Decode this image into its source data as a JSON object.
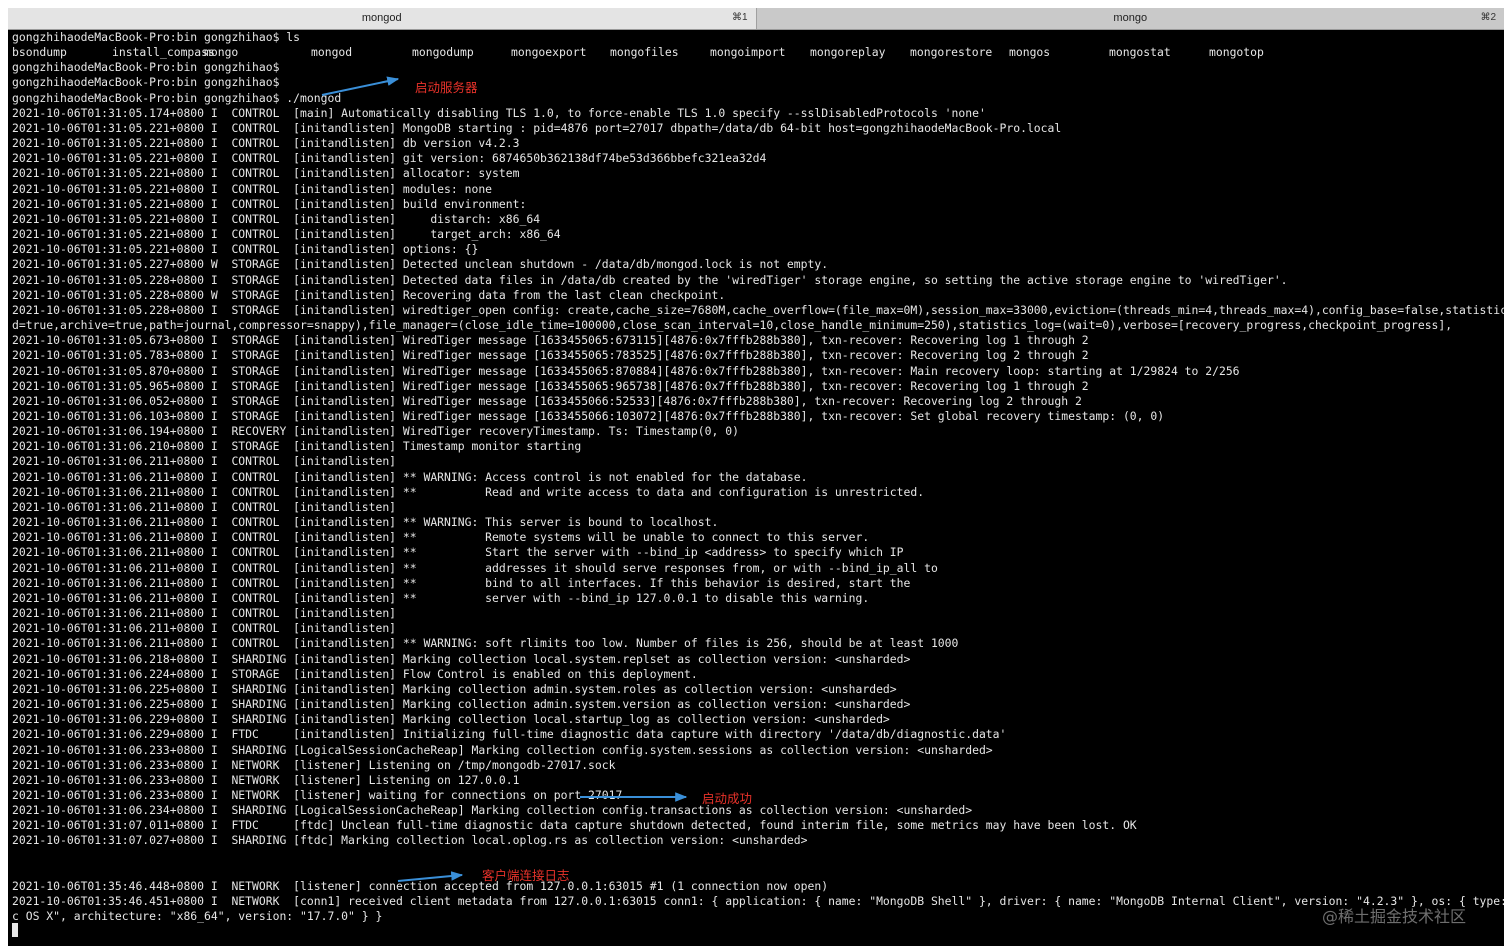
{
  "tabs": [
    {
      "title": "mongod",
      "shortcut": "⌘1"
    },
    {
      "title": "mongo",
      "shortcut": "⌘2"
    }
  ],
  "ls_line": "gongzhihaodeMacBook-Pro:bin gongzhihao$ ls",
  "ls_files": [
    "bsondump",
    "install_compass",
    "mongo",
    "mongod",
    "mongodump",
    "mongoexport",
    "mongofiles",
    "mongoimport",
    "mongoreplay",
    "mongorestore",
    "mongos",
    "mongostat",
    "mongotop"
  ],
  "prompt_lines": [
    "gongzhihaodeMacBook-Pro:bin gongzhihao$",
    "gongzhihaodeMacBook-Pro:bin gongzhihao$",
    "gongzhihaodeMacBook-Pro:bin gongzhihao$ ./mongod"
  ],
  "log1": [
    "2021-10-06T01:31:05.174+0800 I  CONTROL  [main] Automatically disabling TLS 1.0, to force-enable TLS 1.0 specify --sslDisabledProtocols 'none'",
    "2021-10-06T01:31:05.221+0800 I  CONTROL  [initandlisten] MongoDB starting : pid=4876 port=27017 dbpath=/data/db 64-bit host=gongzhihaodeMacBook-Pro.local",
    "2021-10-06T01:31:05.221+0800 I  CONTROL  [initandlisten] db version v4.2.3",
    "2021-10-06T01:31:05.221+0800 I  CONTROL  [initandlisten] git version: 6874650b362138df74be53d366bbefc321ea32d4",
    "2021-10-06T01:31:05.221+0800 I  CONTROL  [initandlisten] allocator: system",
    "2021-10-06T01:31:05.221+0800 I  CONTROL  [initandlisten] modules: none",
    "2021-10-06T01:31:05.221+0800 I  CONTROL  [initandlisten] build environment:",
    "2021-10-06T01:31:05.221+0800 I  CONTROL  [initandlisten]     distarch: x86_64",
    "2021-10-06T01:31:05.221+0800 I  CONTROL  [initandlisten]     target_arch: x86_64",
    "2021-10-06T01:31:05.221+0800 I  CONTROL  [initandlisten] options: {}",
    "2021-10-06T01:31:05.227+0800 W  STORAGE  [initandlisten] Detected unclean shutdown - /data/db/mongod.lock is not empty.",
    "2021-10-06T01:31:05.228+0800 I  STORAGE  [initandlisten] Detected data files in /data/db created by the 'wiredTiger' storage engine, so setting the active storage engine to 'wiredTiger'.",
    "2021-10-06T01:31:05.228+0800 W  STORAGE  [initandlisten] Recovering data from the last clean checkpoint.",
    "2021-10-06T01:31:05.228+0800 I  STORAGE  [initandlisten] wiredtiger_open config: create,cache_size=7680M,cache_overflow=(file_max=0M),session_max=33000,eviction=(threads_min=4,threads_max=4),config_base=false,statistics=(fast),log=(enable",
    "d=true,archive=true,path=journal,compressor=snappy),file_manager=(close_idle_time=100000,close_scan_interval=10,close_handle_minimum=250),statistics_log=(wait=0),verbose=[recovery_progress,checkpoint_progress],",
    "2021-10-06T01:31:05.673+0800 I  STORAGE  [initandlisten] WiredTiger message [1633455065:673115][4876:0x7fffb288b380], txn-recover: Recovering log 1 through 2",
    "2021-10-06T01:31:05.783+0800 I  STORAGE  [initandlisten] WiredTiger message [1633455065:783525][4876:0x7fffb288b380], txn-recover: Recovering log 2 through 2",
    "2021-10-06T01:31:05.870+0800 I  STORAGE  [initandlisten] WiredTiger message [1633455065:870884][4876:0x7fffb288b380], txn-recover: Main recovery loop: starting at 1/29824 to 2/256",
    "2021-10-06T01:31:05.965+0800 I  STORAGE  [initandlisten] WiredTiger message [1633455065:965738][4876:0x7fffb288b380], txn-recover: Recovering log 1 through 2",
    "2021-10-06T01:31:06.052+0800 I  STORAGE  [initandlisten] WiredTiger message [1633455066:52533][4876:0x7fffb288b380], txn-recover: Recovering log 2 through 2",
    "2021-10-06T01:31:06.103+0800 I  STORAGE  [initandlisten] WiredTiger message [1633455066:103072][4876:0x7fffb288b380], txn-recover: Set global recovery timestamp: (0, 0)",
    "2021-10-06T01:31:06.194+0800 I  RECOVERY [initandlisten] WiredTiger recoveryTimestamp. Ts: Timestamp(0, 0)",
    "2021-10-06T01:31:06.210+0800 I  STORAGE  [initandlisten] Timestamp monitor starting",
    "2021-10-06T01:31:06.211+0800 I  CONTROL  [initandlisten]",
    "2021-10-06T01:31:06.211+0800 I  CONTROL  [initandlisten] ** WARNING: Access control is not enabled for the database.",
    "2021-10-06T01:31:06.211+0800 I  CONTROL  [initandlisten] **          Read and write access to data and configuration is unrestricted.",
    "2021-10-06T01:31:06.211+0800 I  CONTROL  [initandlisten]",
    "2021-10-06T01:31:06.211+0800 I  CONTROL  [initandlisten] ** WARNING: This server is bound to localhost.",
    "2021-10-06T01:31:06.211+0800 I  CONTROL  [initandlisten] **          Remote systems will be unable to connect to this server.",
    "2021-10-06T01:31:06.211+0800 I  CONTROL  [initandlisten] **          Start the server with --bind_ip <address> to specify which IP",
    "2021-10-06T01:31:06.211+0800 I  CONTROL  [initandlisten] **          addresses it should serve responses from, or with --bind_ip_all to",
    "2021-10-06T01:31:06.211+0800 I  CONTROL  [initandlisten] **          bind to all interfaces. If this behavior is desired, start the",
    "2021-10-06T01:31:06.211+0800 I  CONTROL  [initandlisten] **          server with --bind_ip 127.0.0.1 to disable this warning.",
    "2021-10-06T01:31:06.211+0800 I  CONTROL  [initandlisten]",
    "2021-10-06T01:31:06.211+0800 I  CONTROL  [initandlisten]",
    "2021-10-06T01:31:06.211+0800 I  CONTROL  [initandlisten] ** WARNING: soft rlimits too low. Number of files is 256, should be at least 1000",
    "2021-10-06T01:31:06.218+0800 I  SHARDING [initandlisten] Marking collection local.system.replset as collection version: <unsharded>",
    "2021-10-06T01:31:06.224+0800 I  STORAGE  [initandlisten] Flow Control is enabled on this deployment.",
    "2021-10-06T01:31:06.225+0800 I  SHARDING [initandlisten] Marking collection admin.system.roles as collection version: <unsharded>",
    "2021-10-06T01:31:06.225+0800 I  SHARDING [initandlisten] Marking collection admin.system.version as collection version: <unsharded>",
    "2021-10-06T01:31:06.229+0800 I  SHARDING [initandlisten] Marking collection local.startup_log as collection version: <unsharded>",
    "2021-10-06T01:31:06.229+0800 I  FTDC     [initandlisten] Initializing full-time diagnostic data capture with directory '/data/db/diagnostic.data'",
    "2021-10-06T01:31:06.233+0800 I  SHARDING [LogicalSessionCacheReap] Marking collection config.system.sessions as collection version: <unsharded>",
    "2021-10-06T01:31:06.233+0800 I  NETWORK  [listener] Listening on /tmp/mongodb-27017.sock",
    "2021-10-06T01:31:06.233+0800 I  NETWORK  [listener] Listening on 127.0.0.1",
    "2021-10-06T01:31:06.233+0800 I  NETWORK  [listener] waiting for connections on port 27017",
    "2021-10-06T01:31:06.234+0800 I  SHARDING [LogicalSessionCacheReap] Marking collection config.transactions as collection version: <unsharded>",
    "2021-10-06T01:31:07.011+0800 I  FTDC     [ftdc] Unclean full-time diagnostic data capture shutdown detected, found interim file, some metrics may have been lost. OK",
    "2021-10-06T01:31:07.027+0800 I  SHARDING [ftdc] Marking collection local.oplog.rs as collection version: <unsharded>"
  ],
  "log2": [
    "2021-10-06T01:35:46.448+0800 I  NETWORK  [listener] connection accepted from 127.0.0.1:63015 #1 (1 connection now open)",
    "2021-10-06T01:35:46.451+0800 I  NETWORK  [conn1] received client metadata from 127.0.0.1:63015 conn1: { application: { name: \"MongoDB Shell\" }, driver: { name: \"MongoDB Internal Client\", version: \"4.2.3\" }, os: { type: \"Darwin\", name: \"Ma",
    "c OS X\", architecture: \"x86_64\", version: \"17.7.0\" } }"
  ],
  "annotations": {
    "start_server": "启动服务器",
    "start_success": "启动成功",
    "client_connect": "客户端连接日志"
  },
  "colors": {
    "annotation_text": "#e8322a",
    "arrow": "#3a8fd8",
    "terminal_bg": "#000000",
    "terminal_text": "#e6e6e6"
  },
  "watermark": "@稀土掘金技术社区"
}
